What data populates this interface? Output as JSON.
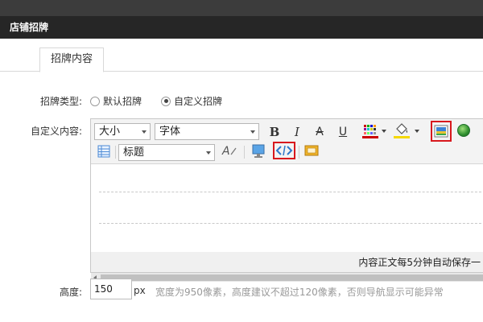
{
  "window": {
    "title": "店铺招牌"
  },
  "tabs": [
    {
      "label": "招牌内容",
      "active": true
    }
  ],
  "form": {
    "type_label": "招牌类型:",
    "type_options": [
      {
        "label": "默认招牌",
        "selected": false
      },
      {
        "label": "自定义招牌",
        "selected": true
      }
    ],
    "content_label": "自定义内容:",
    "height_label": "高度:",
    "height_value": "150",
    "height_unit": "px",
    "height_hint": "宽度为950像素，高度建议不超过120像素，否则导航显示可能异常"
  },
  "editor": {
    "font_size_select": "大小",
    "font_family_select": "字体",
    "heading_select": "标题",
    "buttons": {
      "bold": "B",
      "italic": "I",
      "strike": "A",
      "underline": "U"
    },
    "icons": [
      "text-color-icon",
      "highlight-color-icon",
      "insert-image-icon",
      "web-globe-icon",
      "table-icon",
      "clear-format-icon",
      "insert-media-icon",
      "html-source-icon",
      "flash-icon"
    ],
    "autosave_status": "内容正文每5分钟自动保存一"
  },
  "colors": {
    "titlebar": "#262626",
    "highlight_border": "#d8181d",
    "text_color_bar": "#cc0000",
    "bg_color_bar": "#f5d800"
  }
}
